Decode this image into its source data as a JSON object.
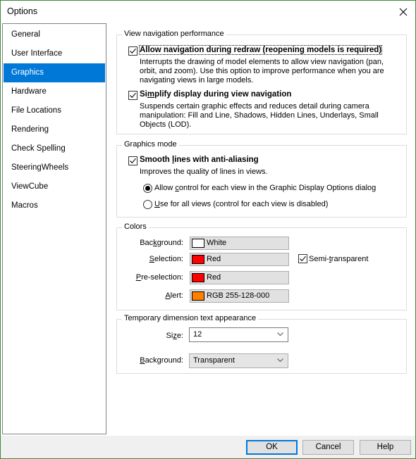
{
  "window": {
    "title": "Options",
    "close_icon": "close-icon"
  },
  "nav": {
    "items": [
      {
        "label": "General",
        "selected": false
      },
      {
        "label": "User Interface",
        "selected": false
      },
      {
        "label": "Graphics",
        "selected": true
      },
      {
        "label": "Hardware",
        "selected": false
      },
      {
        "label": "File Locations",
        "selected": false
      },
      {
        "label": "Rendering",
        "selected": false
      },
      {
        "label": "Check Spelling",
        "selected": false
      },
      {
        "label": "SteeringWheels",
        "selected": false
      },
      {
        "label": "ViewCube",
        "selected": false
      },
      {
        "label": "Macros",
        "selected": false
      }
    ]
  },
  "view_nav": {
    "group_label": "View navigation performance",
    "allow_nav": {
      "label": "Allow navigation during redraw (reopening models is required)",
      "checked": true,
      "description_lines": [
        "Interrupts the drawing of model elements to allow view navigation (pan,",
        "orbit, and zoom). Use this option to improve performance when you are",
        "navigating views in large models."
      ]
    },
    "simplify": {
      "label_pre": "Si",
      "label_u": "m",
      "label_post": "plify display during view navigation",
      "checked": true,
      "description_lines": [
        "Suspends certain graphic effects and reduces detail during camera",
        "manipulation: Fill and Line, Shadows, Hidden Lines, Underlays, Small",
        "Objects (LOD)."
      ]
    }
  },
  "graphics_mode": {
    "group_label": "Graphics mode",
    "smooth": {
      "label_pre": "Smooth ",
      "label_u": "l",
      "label_post": "ines with anti-aliasing",
      "checked": true,
      "description": "Improves the quality of lines in views."
    },
    "radio_allow": {
      "label_pre": "Allow ",
      "label_u": "c",
      "label_post": "ontrol for each view in the Graphic Display Options dialog",
      "selected": true
    },
    "radio_use": {
      "label_pre": "",
      "label_u": "U",
      "label_post": "se for all views (control for each view is disabled)",
      "selected": false
    }
  },
  "colors": {
    "group_label": "Colors",
    "background": {
      "label_pre": "Bac",
      "label_u": "k",
      "label_post": "ground:",
      "value": "White",
      "swatch": "#ffffff"
    },
    "selection": {
      "label_pre": "",
      "label_u": "S",
      "label_post": "election:",
      "value": "Red",
      "swatch": "#ff0000"
    },
    "preselection": {
      "label_pre": "",
      "label_u": "P",
      "label_post": "re-selection:",
      "value": "Red",
      "swatch": "#ff0000"
    },
    "alert": {
      "label_pre": "",
      "label_u": "A",
      "label_post": "lert:",
      "value": "RGB 255-128-000",
      "swatch": "#ff8000"
    },
    "semi_transparent": {
      "label_pre": "Semi-",
      "label_u": "t",
      "label_post": "ransparent",
      "checked": true
    }
  },
  "temp_dim": {
    "group_label": "Temporary dimension text appearance",
    "size": {
      "label_pre": "Si",
      "label_u": "z",
      "label_post": "e:",
      "value": "12"
    },
    "background": {
      "label_pre": "",
      "label_u": "B",
      "label_post": "ackground:",
      "value": "Transparent"
    }
  },
  "footer": {
    "ok_label": "OK",
    "cancel_label": "Cancel",
    "help_label": "Help"
  }
}
